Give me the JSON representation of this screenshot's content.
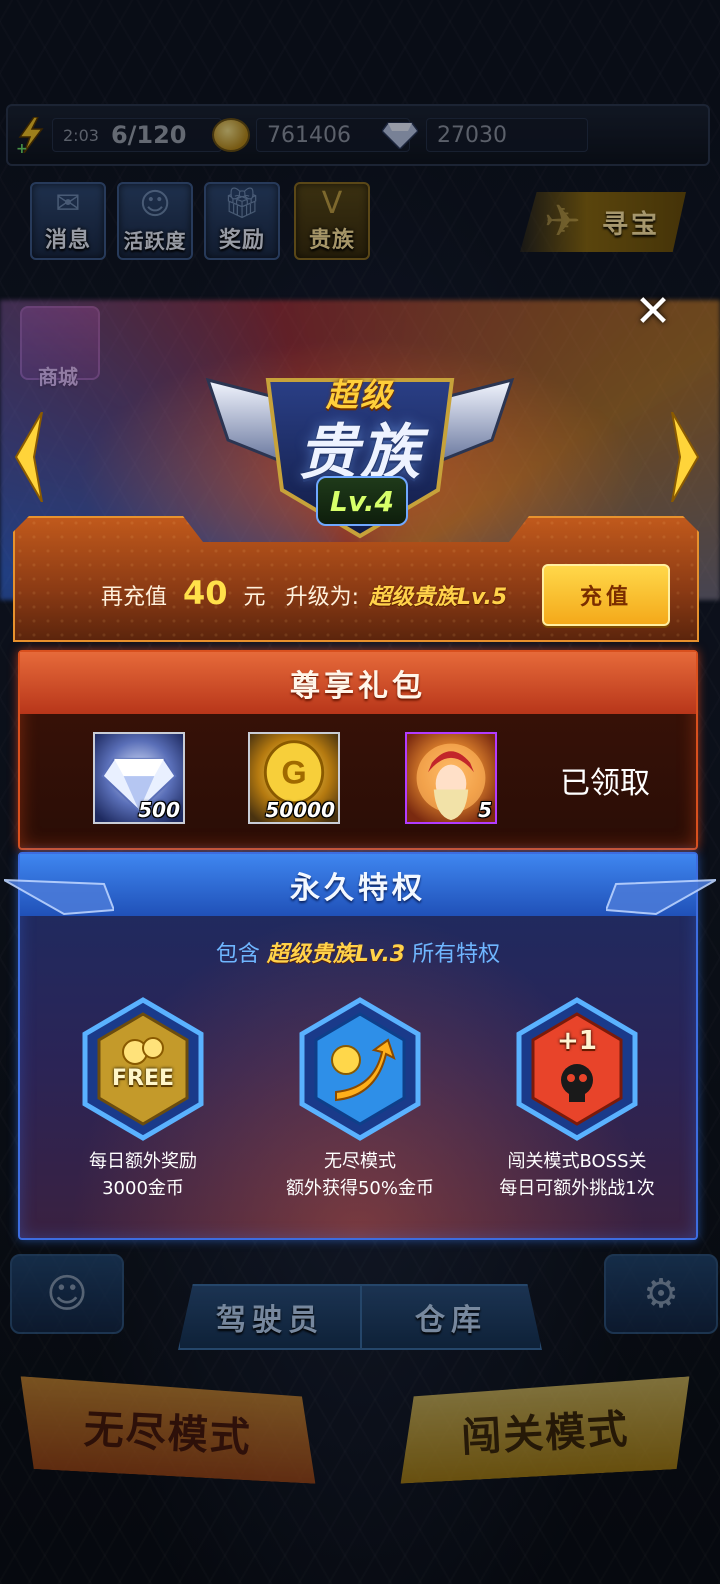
{
  "resources": {
    "stamina_time": "2:03",
    "stamina": "6/120",
    "gold": "761406",
    "diamonds": "27030"
  },
  "top_buttons": {
    "messages": "消息",
    "activity": "活跃度",
    "rewards": "奖励",
    "noble": "贵族",
    "treasure": "寻宝",
    "shop": "商城"
  },
  "bottom_buttons": {
    "pilot": "驾驶员",
    "warehouse": "仓库",
    "endless_mode": "无尽模式",
    "stage_mode": "闯关模式"
  },
  "modal": {
    "close": "✕",
    "badge_top": "超级",
    "badge_main": "贵族",
    "badge_level": "Lv.4",
    "recharge_prefix": "再充值",
    "recharge_amount": "40",
    "recharge_unit": "元",
    "upgrade_label": "升级为:",
    "upgrade_target": "超级贵族Lv.5",
    "recharge_button": "充值",
    "gift_title": "尊享礼包",
    "gift_items": [
      {
        "icon": "diamond-icon",
        "qty": "500"
      },
      {
        "icon": "gold-coin-icon",
        "qty": "50000"
      },
      {
        "icon": "hero-portrait-icon",
        "qty": "5"
      }
    ],
    "gift_status": "已领取",
    "perm_title": "永久特权",
    "perm_sub_prefix": "包含",
    "perm_sub_highlight": "超级贵族Lv.3",
    "perm_sub_suffix": "所有特权",
    "perks": [
      {
        "icon": "free-coins-icon",
        "badge": "FREE",
        "line1": "每日额外奖励",
        "line2": "3000金币"
      },
      {
        "icon": "coin-boost-icon",
        "badge": "",
        "line1": "无尽模式",
        "line2": "额外获得50%金币"
      },
      {
        "icon": "skull-plus-one-icon",
        "badge": "+1",
        "line1": "闯关模式BOSS关",
        "line2": "每日可额外挑战1次"
      }
    ]
  },
  "colors": {
    "accent_gold": "#ffd24a",
    "gift_red": "#d9501e",
    "perm_blue": "#3d6de0"
  }
}
